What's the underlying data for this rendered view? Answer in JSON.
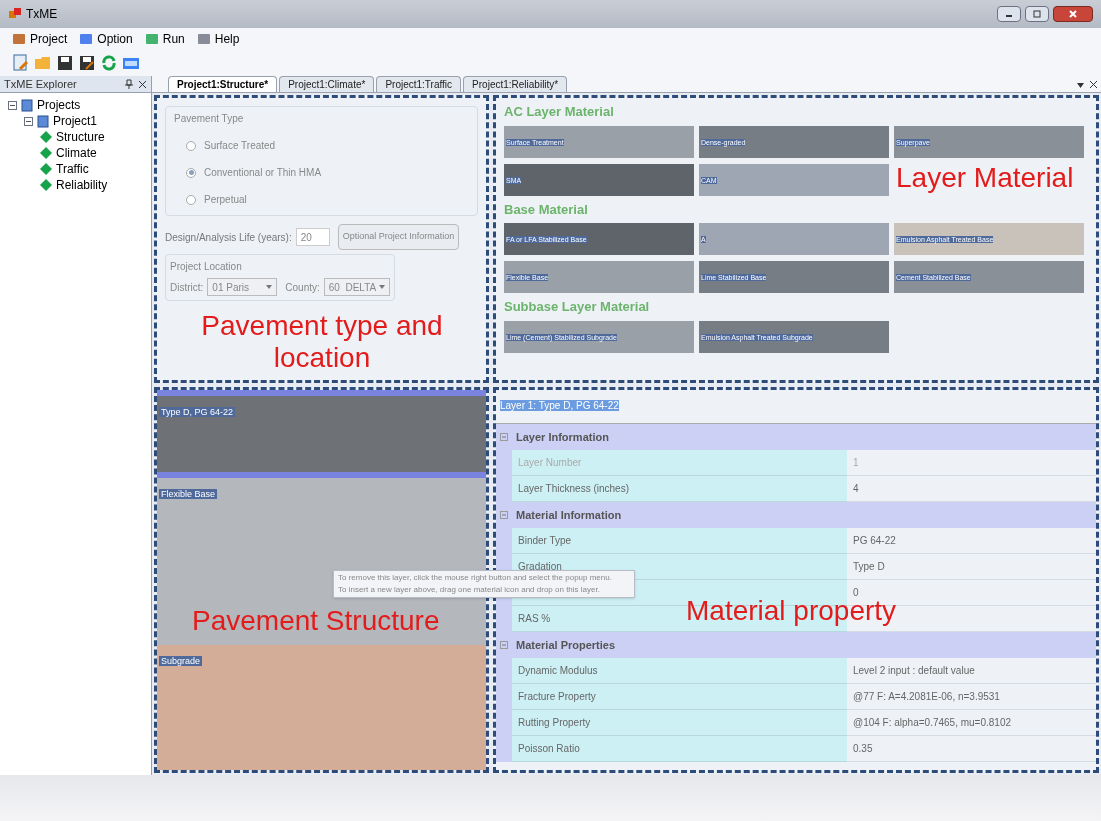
{
  "window": {
    "title": "TxME"
  },
  "menu": [
    {
      "label": "Project"
    },
    {
      "label": "Option"
    },
    {
      "label": "Run"
    },
    {
      "label": "Help"
    }
  ],
  "explorer": {
    "title": "TxME Explorer",
    "tree": [
      {
        "label": "Projects",
        "expanded": true,
        "children": [
          {
            "label": "Project1",
            "expanded": true,
            "children": [
              {
                "label": "Structure"
              },
              {
                "label": "Climate"
              },
              {
                "label": "Traffic"
              },
              {
                "label": "Reliability"
              }
            ]
          }
        ]
      }
    ]
  },
  "tabs": [
    {
      "label": "Project1:Structure*",
      "selected": true
    },
    {
      "label": "Project1:Climate*",
      "selected": false
    },
    {
      "label": "Project1:Traffic",
      "selected": false
    },
    {
      "label": "Project1:Reliability*",
      "selected": false
    }
  ],
  "pavement_type": {
    "title": "Pavement Type",
    "options": [
      {
        "label": "Surface Treated",
        "selected": false
      },
      {
        "label": "Conventional or Thin HMA",
        "selected": true
      },
      {
        "label": "Perpetual",
        "selected": false
      }
    ]
  },
  "design_life": {
    "label": "Design/Analysis Life (years):",
    "value": "20"
  },
  "optional_button": "Optional Project Information",
  "location": {
    "title": "Project Location",
    "district_label": "District:",
    "district": "01 Paris",
    "county_label": "County:",
    "county": "60  DELTA"
  },
  "material_groups": [
    {
      "title": "AC Layer Material",
      "tiles": [
        {
          "label": "Surface Treatment"
        },
        {
          "label": "Dense-graded"
        },
        {
          "label": "Superpave"
        },
        {
          "label": "SMA"
        },
        {
          "label": "CAM"
        }
      ]
    },
    {
      "title": "Base Material",
      "tiles": [
        {
          "label": "FA or LFA Stabilized Base"
        },
        {
          "label": "A"
        },
        {
          "label": "Emulsion Asphalt Treated Base"
        },
        {
          "label": "Flexible Base"
        },
        {
          "label": "Lime Stabilized Base"
        },
        {
          "label": "Cement Stabilized Base"
        }
      ]
    },
    {
      "title": "Subbase Layer Material",
      "tiles": [
        {
          "label": "Lime (Cement) Stabilized Subgrade"
        },
        {
          "label": "Emulsion Asphalt Treated Subgrade"
        }
      ]
    }
  ],
  "layers": [
    {
      "label": "Type D, PG 64-22",
      "kind": "asphalt",
      "selected": true
    },
    {
      "label": "Flexible Base",
      "kind": "base",
      "selected": false
    },
    {
      "label": "Subgrade",
      "kind": "soil",
      "selected": false
    }
  ],
  "tooltip": [
    "To remove this layer, click the mouse right button and select the popup menu.",
    "To insert a new layer above, drag one material icon and drop on this layer."
  ],
  "property_grid": {
    "title": "Layer 1: Type D, PG 64-22",
    "sections": [
      {
        "title": "Layer Information",
        "expanded": true,
        "rows": [
          {
            "label": "Layer Number",
            "value": "1",
            "disabled": true
          },
          {
            "label": "Layer Thickness (inches)",
            "value": "4",
            "disabled": false
          }
        ]
      },
      {
        "title": "Material Information",
        "expanded": true,
        "rows": [
          {
            "label": "Binder Type",
            "value": "PG 64-22",
            "disabled": false
          },
          {
            "label": "Gradation",
            "value": "Type D",
            "disabled": false
          },
          {
            "value": "0",
            "disabled": false
          },
          {
            "label": "RAS %",
            "disabled": false
          }
        ]
      },
      {
        "title": "Material Properties",
        "expanded": true,
        "rows": [
          {
            "label": "Dynamic Modulus",
            "value": "Level 2 input : default value",
            "disabled": false
          },
          {
            "label": "Fracture Property",
            "value": "@77 F: A=4.2081E-06, n=3.9531",
            "disabled": false
          },
          {
            "label": "Rutting Property",
            "value": "@104 F: alpha=0.7465, mu=0.8102",
            "disabled": false
          },
          {
            "label": "Poisson Ratio",
            "value": "0.35",
            "disabled": false
          }
        ]
      }
    ]
  },
  "annotations": {
    "type_location": "Pavement type and location",
    "layer_material": "Layer Material",
    "structure": "Pavement Structure",
    "property": "Material property"
  }
}
